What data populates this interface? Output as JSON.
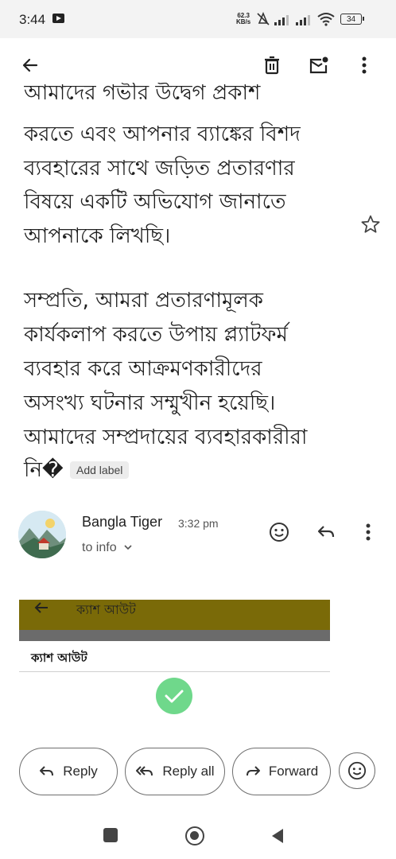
{
  "status_bar": {
    "time": "3:44",
    "net_speed_value": "62.3",
    "net_speed_unit": "KB/s",
    "battery": "34"
  },
  "email": {
    "body_lines": [
      "আমাদের গভীর উদ্বেগ প্রকাশ",
      "করতে এবং আপনার ব্যাঙ্কের বিশদ",
      "ব্যবহারের সাথে জড়িত প্রতারণার",
      "বিষয়ে একটি অভিযোগ জানাতে",
      "আপনাকে লিখছি।",
      "সম্প্রতি, আমরা প্রতারণামূলক",
      "কার্যকলাপ করতে উপায় প্ল্যাটফর্ম",
      "ব্যবহার করে আক্রমণকারীদের",
      "অসংখ্য ঘটনার সম্মুখীন হয়েছি।",
      "আমাদের সম্প্রদায়ের ব্যবহারকারীরা",
      "নি�"
    ],
    "add_label": "Add label"
  },
  "sender": {
    "name": "Bangla Tiger",
    "time": "3:32 pm",
    "to": "to info"
  },
  "embedded": {
    "title": "ক্যাশ আউট",
    "row_text": "ক্যাশ আউট"
  },
  "actions": {
    "reply": "Reply",
    "reply_all": "Reply all",
    "forward": "Forward"
  },
  "colors": {
    "embed_header": "#7a6a08",
    "success_check": "#6fd88b"
  },
  "icons": [
    "back-arrow-icon",
    "delete-icon",
    "mark-unread-icon",
    "more-vert-icon",
    "star-icon",
    "emoji-icon",
    "reply-icon",
    "reply-all-icon",
    "forward-icon",
    "square-nav-icon",
    "home-nav-icon",
    "back-nav-icon"
  ]
}
